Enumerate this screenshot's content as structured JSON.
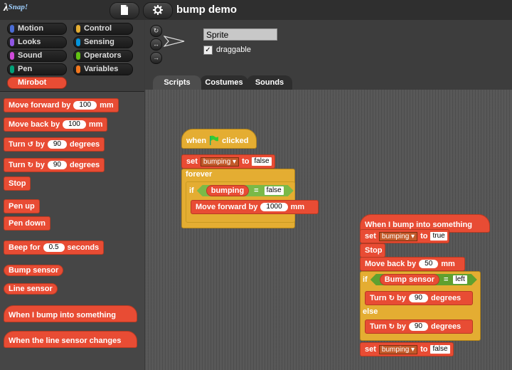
{
  "app": {
    "logo": "λ",
    "logo_suffix": "Snap!",
    "project_title": "bump demo"
  },
  "categories": [
    {
      "label": "Motion",
      "color": "#4a6cd4"
    },
    {
      "label": "Control",
      "color": "#e4ad32"
    },
    {
      "label": "Looks",
      "color": "#8f56e3"
    },
    {
      "label": "Sensing",
      "color": "#0494dc"
    },
    {
      "label": "Sound",
      "color": "#cf4ad9"
    },
    {
      "label": "Operators",
      "color": "#62c213"
    },
    {
      "label": "Pen",
      "color": "#00a178"
    },
    {
      "label": "Variables",
      "color": "#f3761d"
    },
    {
      "label": "Mirobot",
      "color": "#e84c34"
    }
  ],
  "palette": {
    "move_forward": {
      "pre": "Move forward by",
      "val": "100",
      "post": "mm"
    },
    "move_back": {
      "pre": "Move back by",
      "val": "100",
      "post": "mm"
    },
    "turn_left": {
      "pre": "Turn",
      "by": "by",
      "val": "90",
      "post": "degrees"
    },
    "turn_right": {
      "pre": "Turn",
      "by": "by",
      "val": "90",
      "post": "degrees"
    },
    "stop": "Stop",
    "pen_up": "Pen up",
    "pen_down": "Pen down",
    "beep": {
      "pre": "Beep for",
      "val": "0.5",
      "post": "seconds"
    },
    "bump_sensor": "Bump sensor",
    "line_sensor": "Line sensor",
    "when_bump": "When I bump into something",
    "when_line": "When the line sensor changes"
  },
  "sprite": {
    "name": "Sprite",
    "draggable_label": "draggable",
    "draggable_checked": "✓"
  },
  "tabs": [
    "Scripts",
    "Costumes",
    "Sounds"
  ],
  "script1": {
    "when": "when",
    "clicked": "clicked",
    "set": "set",
    "var": "bumping",
    "to": "to",
    "value": "false",
    "forever": "forever",
    "if": "if",
    "reporter": "bumping",
    "eq": "=",
    "cmp": "false",
    "move": "Move forward by",
    "move_val": "1000",
    "mm": "mm"
  },
  "script2": {
    "hat": "When I bump into something",
    "set1": "set",
    "var1": "bumping",
    "to1": "to",
    "val1": "true",
    "stop": "Stop",
    "back": "Move back by",
    "back_val": "50",
    "mm": "mm",
    "if": "if",
    "sensor": "Bump sensor",
    "eq": "=",
    "cmp": "left",
    "turn1": "Turn",
    "by1": "by",
    "turn1_val": "90",
    "deg1": "degrees",
    "else": "else",
    "turn2": "Turn",
    "by2": "by",
    "turn2_val": "90",
    "deg2": "degrees",
    "set2": "set",
    "var2": "bumping",
    "to2": "to",
    "val2": "false"
  }
}
